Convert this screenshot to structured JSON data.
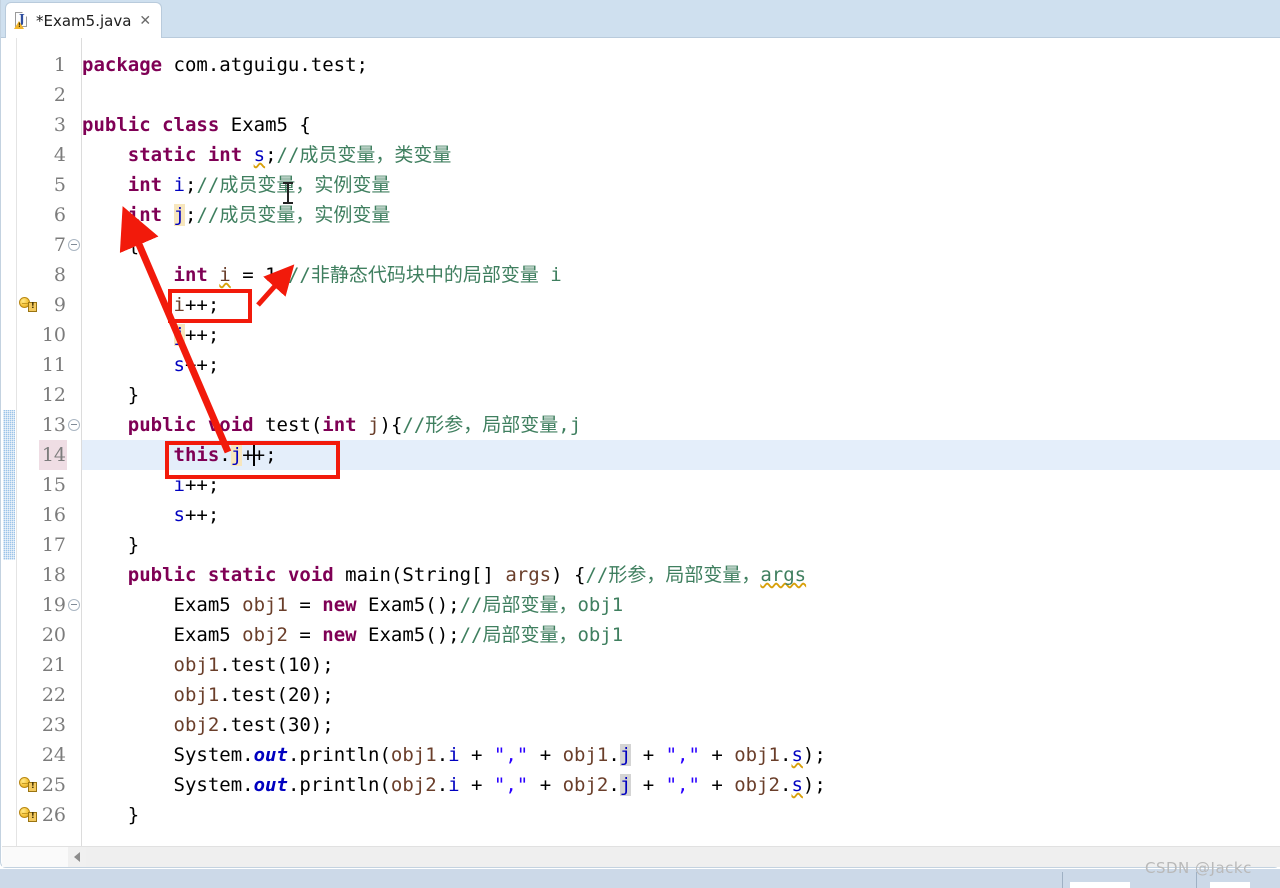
{
  "window": {
    "kind": "eclipse-java-editor"
  },
  "tab": {
    "title": "*Exam5.java",
    "close_label": "✕",
    "icon_letter": "J"
  },
  "editor": {
    "current_line": 14,
    "change_bar_lines": [
      13,
      14,
      15,
      16,
      17
    ],
    "warning_lines": [
      8,
      24,
      25
    ],
    "fold_lines": [
      7,
      13,
      18
    ],
    "lines": [
      {
        "n": 1,
        "text": "package com.atguigu.test;"
      },
      {
        "n": 2,
        "text": ""
      },
      {
        "n": 3,
        "text": "public class Exam5 {"
      },
      {
        "n": 4,
        "text": "    static int s;//成员变量，类变量"
      },
      {
        "n": 5,
        "text": "    int i;//成员变量，实例变量"
      },
      {
        "n": 6,
        "text": "    int j;//成员变量，实例变量"
      },
      {
        "n": 7,
        "text": "    {"
      },
      {
        "n": 8,
        "text": "        int i = 1;//非静态代码块中的局部变量 i"
      },
      {
        "n": 9,
        "text": "        i++;"
      },
      {
        "n": 10,
        "text": "        j++;"
      },
      {
        "n": 11,
        "text": "        s++;"
      },
      {
        "n": 12,
        "text": "    }"
      },
      {
        "n": 13,
        "text": "    public void test(int j){//形参，局部变量,j"
      },
      {
        "n": 14,
        "text": "        this.j++;"
      },
      {
        "n": 15,
        "text": "        i++;"
      },
      {
        "n": 16,
        "text": "        s++;"
      },
      {
        "n": 17,
        "text": "    }"
      },
      {
        "n": 18,
        "text": "    public static void main(String[] args) {//形参，局部变量， args"
      },
      {
        "n": 19,
        "text": "        Exam5 obj1 = new Exam5();//局部变量，obj1"
      },
      {
        "n": 20,
        "text": "        Exam5 obj2 = new Exam5();//局部变量，obj1"
      },
      {
        "n": 21,
        "text": "        obj1.test(10);"
      },
      {
        "n": 22,
        "text": "        obj1.test(20);"
      },
      {
        "n": 23,
        "text": "        obj2.test(30);"
      },
      {
        "n": 24,
        "text": "        System.out.println(obj1.i + \",\" + obj1.j + \",\" + obj1.s);"
      },
      {
        "n": 25,
        "text": "        System.out.println(obj2.i + \",\" + obj2.j + \",\" + obj2.s);"
      },
      {
        "n": 26,
        "text": "    }"
      }
    ],
    "tokens": {
      "package": "package",
      "public": "public",
      "class": "class",
      "static": "static",
      "void": "void",
      "int": "int",
      "new": "new",
      "this": "this",
      "type_exam5": "Exam5",
      "type_string": "String",
      "ident_s": "s",
      "ident_i": "i",
      "ident_j": "j",
      "ident_args": "args",
      "ident_obj1": "obj1",
      "ident_obj2": "obj2",
      "ident_test": "test",
      "ident_system": "System",
      "ident_out": "out",
      "ident_println": "println",
      "str_comma": "\",\"",
      "num_1": "1",
      "num_10": "10",
      "num_20": "20",
      "num_30": "30",
      "pkg_name": "com.atguigu.test;"
    },
    "comments": {
      "l4": "//成员变量，类变量",
      "l5": "//成员变量，实例变量",
      "l6": "//成员变量，实例变量",
      "l8": "//非静态代码块中的局部变量 i",
      "l13": "//形参，局部变量,j",
      "l18a": "//形参，局部变量，",
      "l18b": "args",
      "l19": "//局部变量，obj1",
      "l20": "//局部变量，obj1"
    }
  },
  "annotations": {
    "boxes": [
      {
        "id": "box-i-increment",
        "target": "i++; on line 9"
      },
      {
        "id": "box-this-j-increment",
        "target": "this.j++; on line 14"
      }
    ],
    "arrows": [
      {
        "id": "arrow-to-field-j",
        "from": "this.j++ (line 14)",
        "to": "int j (line 6)"
      },
      {
        "id": "arrow-to-local-i",
        "from": "i++ (line 9)",
        "to": "int i = 1 (line 8)"
      }
    ],
    "color": "#f21a0b"
  },
  "colors": {
    "keyword": "#7F0055",
    "comment": "#3F7F5F",
    "string": "#2A00FF",
    "field": "#0000C0",
    "local": "#6A3E2A",
    "occurrence_write": "#F7E6BD",
    "occurrence_read": "#D4D4D4",
    "current_line": "#E4EEFA",
    "change_bar": "#9CC3E8",
    "tab_bar": "#CFE0EF"
  },
  "scrollbar": {
    "left_arrow": "◀"
  },
  "watermark": {
    "text": "CSDN @Jackc"
  }
}
